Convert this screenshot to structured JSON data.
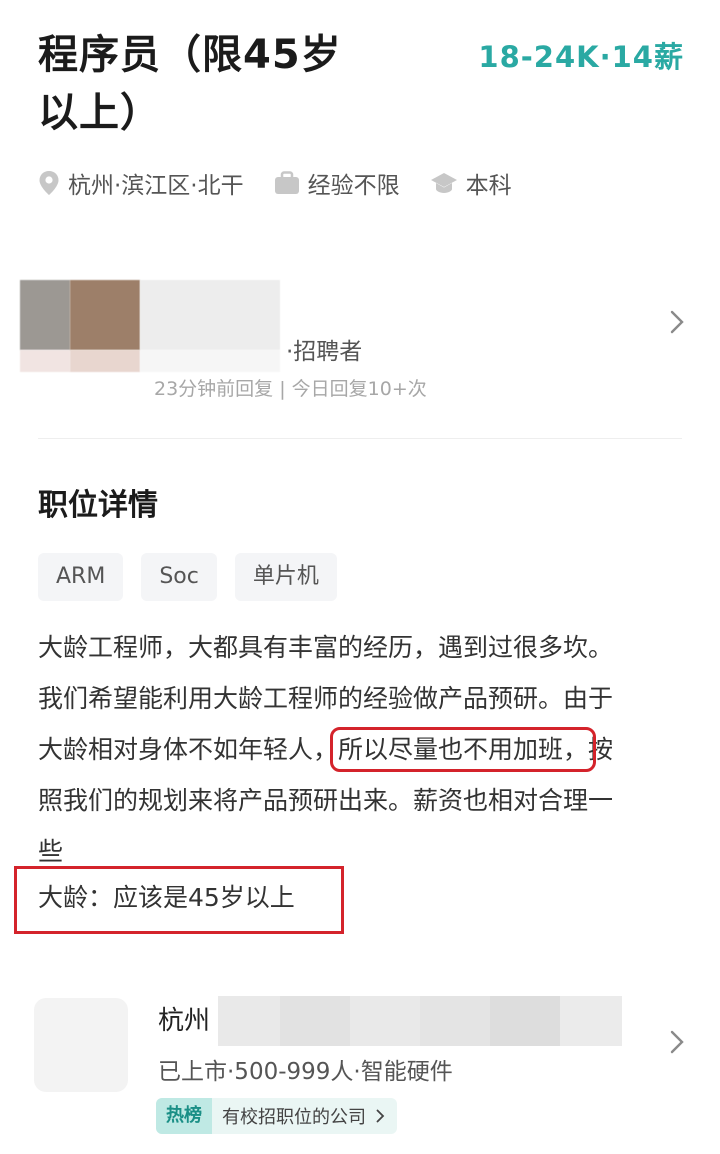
{
  "job": {
    "title": "程序员（限45岁以上）",
    "salary": "18-24K·14薪",
    "location": "杭州·滨江区·北干",
    "experience": "经验不限",
    "education": "本科"
  },
  "recruiter": {
    "role": "·招聘者",
    "status": "23分钟前回复 | 今日回复10+次"
  },
  "details": {
    "section_title": "职位详情",
    "tags": [
      "ARM",
      "Soc",
      "单片机"
    ],
    "desc_line1": "大龄工程师，大都具有丰富的经历，遇到过很多坎。",
    "desc_line2": "我们希望能利用大龄工程师的经验做产品预研。由于",
    "desc_line3_pre": "大龄相对身体不如年轻人，",
    "desc_line3_hl": "所以尽量也不用加班，",
    "desc_line3_post": "按",
    "desc_line4": "照我们的规划来将产品预研出来。薪资也相对合理一",
    "desc_line5": "些",
    "age_note": "大龄：应该是45岁以上"
  },
  "company": {
    "city": "杭州",
    "meta": "已上市·500-999人·智能硬件",
    "hot_label": "热榜",
    "hot_text": "有校招职位的公司"
  },
  "colors": {
    "accent": "#2aa9a3",
    "highlight_border": "#d4232b"
  }
}
